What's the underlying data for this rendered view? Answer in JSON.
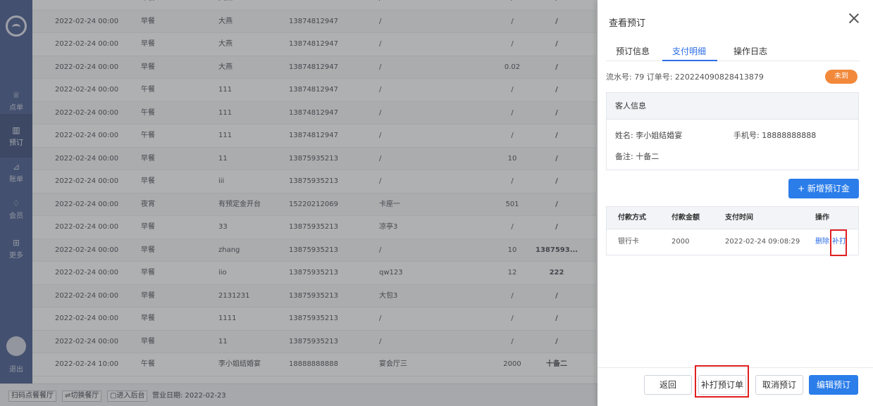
{
  "sidebar": {
    "items": [
      {
        "icon": "bell-service-icon",
        "glyph": "♕",
        "label": "点单",
        "active": false
      },
      {
        "icon": "table-icon",
        "glyph": "▥",
        "label": "预订",
        "active": true
      },
      {
        "icon": "chart-icon",
        "glyph": "⊿",
        "label": "账单",
        "active": false
      },
      {
        "icon": "diamond-icon",
        "glyph": "♢",
        "label": "会员",
        "active": false
      },
      {
        "icon": "grid-icon",
        "glyph": "⊞",
        "label": "更多",
        "active": false
      }
    ],
    "logout_label": "退出"
  },
  "table": {
    "rows": [
      [
        "2022-02-24 00:00",
        "早餐",
        "大燕",
        "13874812947",
        "/",
        "/",
        "/"
      ],
      [
        "2022-02-24 00:00",
        "早餐",
        "大燕",
        "13874812947",
        "/",
        "/",
        "/"
      ],
      [
        "2022-02-24 00:00",
        "早餐",
        "大燕",
        "13874812947",
        "/",
        "/",
        "/"
      ],
      [
        "2022-02-24 00:00",
        "早餐",
        "大燕",
        "13874812947",
        "/",
        "0.02",
        "/"
      ],
      [
        "2022-02-24 00:00",
        "午餐",
        "111",
        "13874812947",
        "/",
        "/",
        "/"
      ],
      [
        "2022-02-24 00:00",
        "午餐",
        "111",
        "13874812947",
        "/",
        "/",
        "/"
      ],
      [
        "2022-02-24 00:00",
        "午餐",
        "111",
        "13874812947",
        "/",
        "/",
        "/"
      ],
      [
        "2022-02-24 00:00",
        "早餐",
        "11",
        "13875935213",
        "/",
        "10",
        "/"
      ],
      [
        "2022-02-24 00:00",
        "早餐",
        "iii",
        "13875935213",
        "/",
        "/",
        "/"
      ],
      [
        "2022-02-24 00:00",
        "夜宵",
        "有预定金开台",
        "15220212069",
        "卡座一",
        "501",
        "/"
      ],
      [
        "2022-02-24 00:00",
        "早餐",
        "33",
        "13875935213",
        "凉亭3",
        "/",
        "/"
      ],
      [
        "2022-02-24 00:00",
        "早餐",
        "zhang",
        "13875935213",
        "/",
        "10",
        "1387593..."
      ],
      [
        "2022-02-24 00:00",
        "早餐",
        "iio",
        "13875935213",
        "qw123",
        "12",
        "222"
      ],
      [
        "2022-02-24 00:00",
        "早餐",
        "2131231",
        "13875935213",
        "大包3",
        "/",
        "/"
      ],
      [
        "2022-02-24 00:00",
        "早餐",
        "1111",
        "13875935213",
        "/",
        "/",
        "/"
      ],
      [
        "2022-02-24 00:00",
        "早餐",
        "11",
        "13875935213",
        "/",
        "/",
        "/"
      ],
      [
        "2022-02-24 10:00",
        "午餐",
        "李小姐结婚宴",
        "18888888888",
        "宴会厅三",
        "2000",
        "十备二"
      ]
    ]
  },
  "statusbar": {
    "scan": "扫码点餐餐厅",
    "switch": "⇌切换餐厅",
    "backend": "▢进入后台",
    "business_date": "营业日期: 2022-02-23"
  },
  "drawer": {
    "title": "查看预订",
    "tabs": [
      "预订信息",
      "支付明细",
      "操作日志"
    ],
    "order_line": "流水号: 79   订单号: 220224090828413879",
    "badge": "未到",
    "guest_head": "客人信息",
    "guest_name": "姓名: 李小姐结婚宴",
    "guest_phone": "手机号: 18888888888",
    "guest_note": "备注: 十备二",
    "add_deposit": "+ 新增预订金",
    "pay_headers": [
      "付款方式",
      "付款金额",
      "支付时间",
      "操作"
    ],
    "pay_row": {
      "method": "银行卡",
      "amount": "2000",
      "time": "2022-02-24 09:08:29",
      "delete": "删除",
      "reprint": "补打"
    },
    "footer": {
      "back": "返回",
      "reprint_order": "补打预订单",
      "cancel": "取消预订",
      "edit": "编辑预订"
    }
  },
  "colors": {
    "primary": "#2b7de9",
    "badge": "#f2883a",
    "highlight": "#e02020",
    "sidebar": "#4a5d8f"
  }
}
